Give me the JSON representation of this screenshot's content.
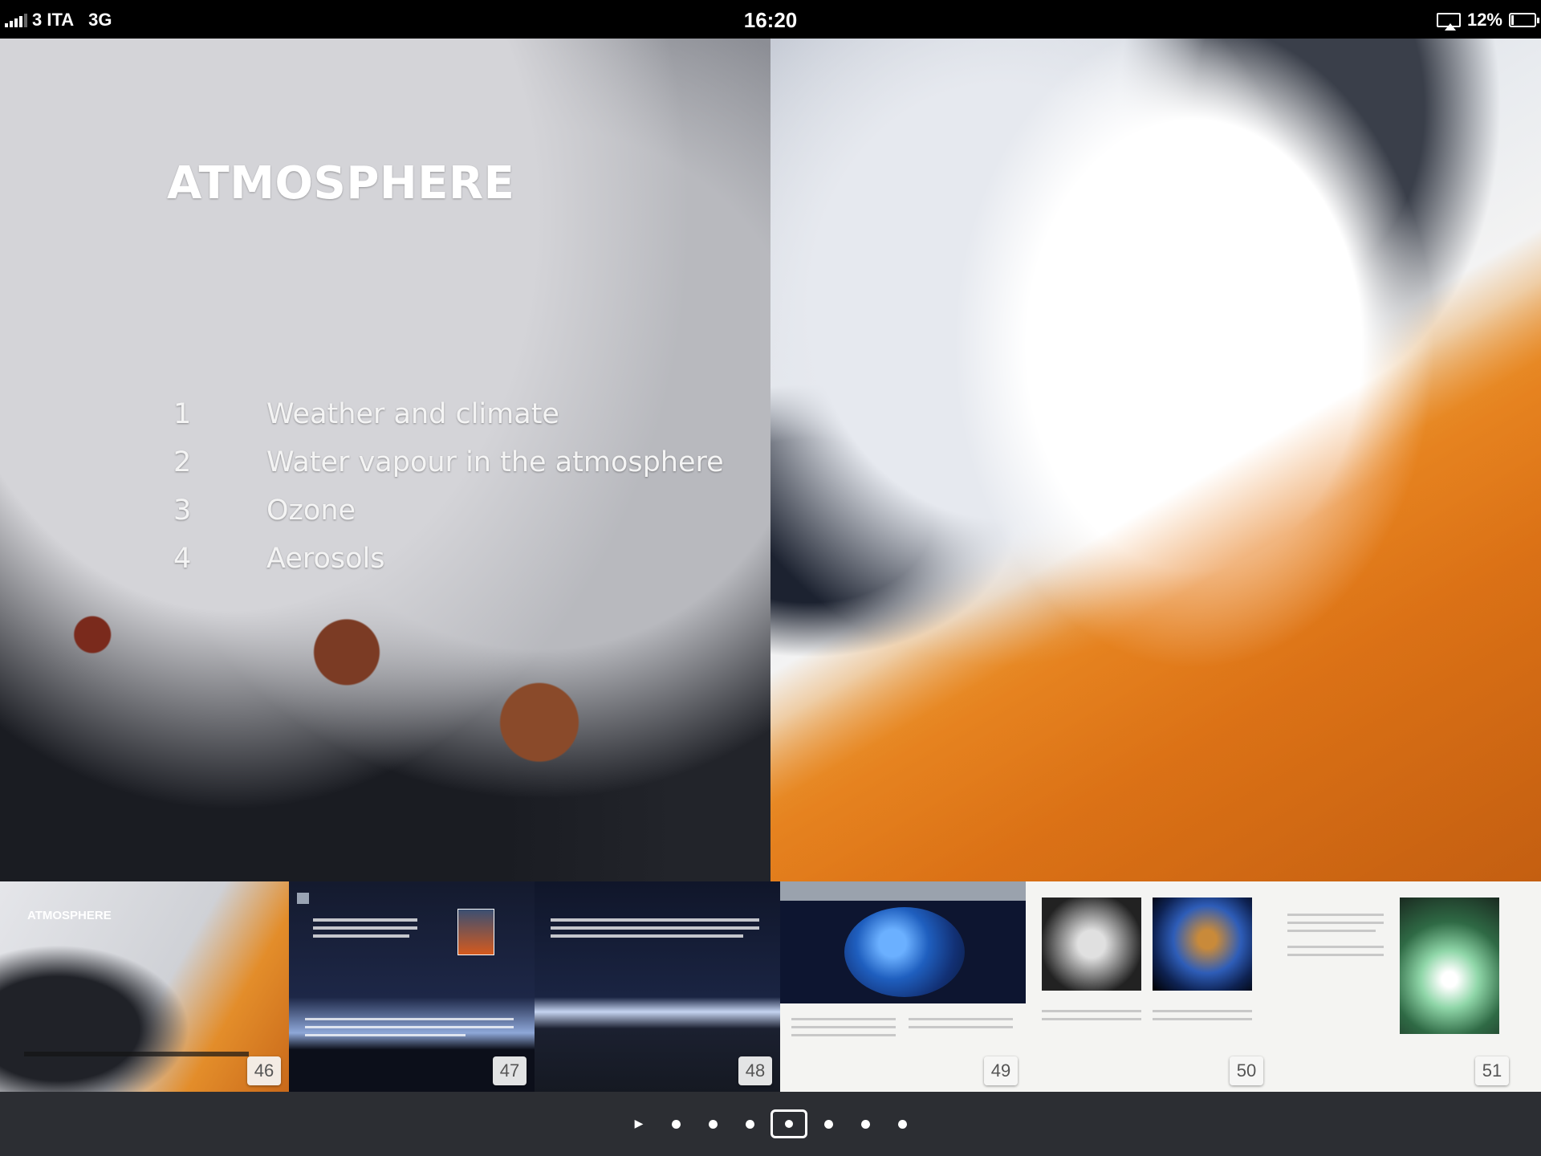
{
  "status_bar": {
    "carrier": "3 ITA",
    "network": "3G",
    "time": "16:20",
    "battery_percent": "12%",
    "battery_level": 0.12
  },
  "chapter": {
    "title": "ATMOSPHERE",
    "toc": [
      {
        "num": "1",
        "label": "Weather and climate"
      },
      {
        "num": "2",
        "label": "Water vapour in the atmosphere"
      },
      {
        "num": "3",
        "label": "Ozone"
      },
      {
        "num": "4",
        "label": "Aerosols"
      }
    ]
  },
  "thumbnails": [
    {
      "page": "46",
      "label": "ATMOSPHERE"
    },
    {
      "page": "47"
    },
    {
      "page": "48"
    },
    {
      "page": "49"
    },
    {
      "page": "50"
    },
    {
      "page": "51"
    }
  ],
  "page_control": {
    "dot_count": 7,
    "active_index": 3
  },
  "colors": {
    "status_bar_bg": "#000000",
    "control_bar_bg": "#2c2e33",
    "strip_bg": "#b9bdc2",
    "desert_orange": "#d9731a"
  }
}
